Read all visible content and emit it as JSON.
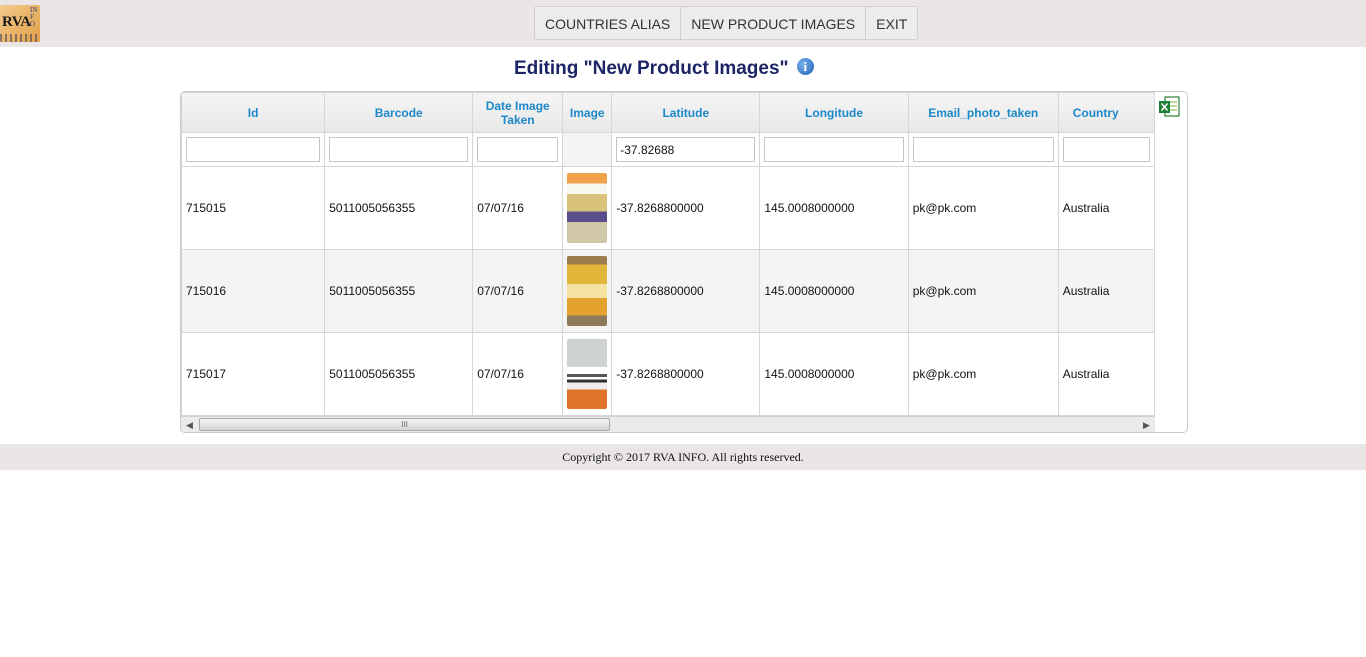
{
  "logo": {
    "text": "RVA",
    "subtext": "INFO"
  },
  "menu": {
    "items": [
      "COUNTRIES ALIAS",
      "NEW PRODUCT IMAGES",
      "EXIT"
    ]
  },
  "page": {
    "title": "Editing \"New Product Images\"",
    "info_icon": "info-icon"
  },
  "grid": {
    "export_icon": "excel-export-icon",
    "columns": [
      "Id",
      "Barcode",
      "Date Image Taken",
      "Image",
      "Latitude",
      "Longitude",
      "Email_photo_taken",
      "Country"
    ],
    "filters": {
      "id": "",
      "barcode": "",
      "date": "",
      "latitude": "-37.82688",
      "longitude": "",
      "email": "",
      "country": ""
    },
    "rows": [
      {
        "id": "715015",
        "barcode": "5011005056355",
        "date": "07/07/16",
        "latitude": "-37.8268800000",
        "longitude": "145.0008000000",
        "email": "pk@pk.com",
        "country": "Australia"
      },
      {
        "id": "715016",
        "barcode": "5011005056355",
        "date": "07/07/16",
        "latitude": "-37.8268800000",
        "longitude": "145.0008000000",
        "email": "pk@pk.com",
        "country": "Australia"
      },
      {
        "id": "715017",
        "barcode": "5011005056355",
        "date": "07/07/16",
        "latitude": "-37.8268800000",
        "longitude": "145.0008000000",
        "email": "pk@pk.com",
        "country": "Australia"
      }
    ],
    "scroll_thumb_label": "III"
  },
  "footer": {
    "text": "Copyright © 2017 RVA INFO. All rights reserved."
  }
}
